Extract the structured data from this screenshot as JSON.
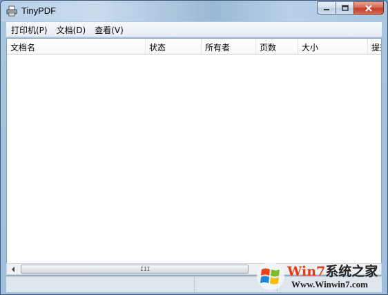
{
  "window": {
    "title": "TinyPDF"
  },
  "menu": [
    "打印机(P)",
    "文档(D)",
    "查看(V)"
  ],
  "columns": [
    {
      "label": "文档名"
    },
    {
      "label": "状态"
    },
    {
      "label": "所有者"
    },
    {
      "label": "页数"
    },
    {
      "label": "大小"
    },
    {
      "label": "提交"
    }
  ],
  "rows": [],
  "scrollbar": {
    "grip": "III"
  },
  "watermark": {
    "brand_prefix": "Win",
    "brand_digit": "7",
    "brand_suffix": "系统之家",
    "url": "Www.Winwin7.com"
  },
  "colors": {
    "title_bar": "#b7d0e8",
    "close_button": "#c0402b",
    "watermark_orange": "#f2a514"
  }
}
